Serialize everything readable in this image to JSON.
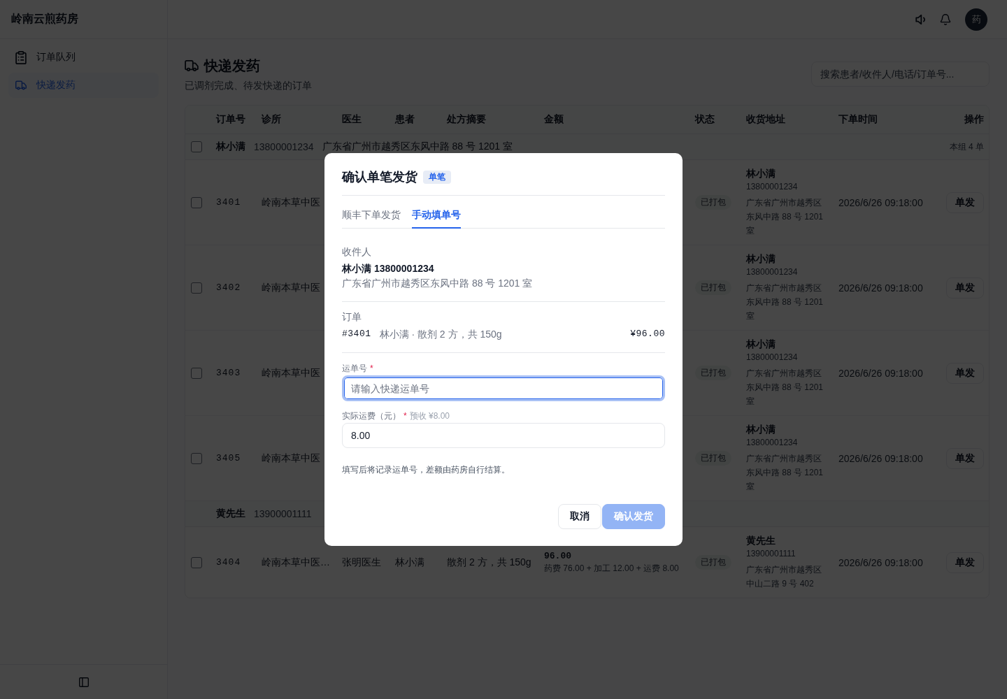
{
  "sidebar": {
    "brand": "岭南云煎药房",
    "items": [
      {
        "label": "订单队列",
        "selected": false
      },
      {
        "label": "快递发药",
        "selected": true
      }
    ]
  },
  "topbar": {
    "avatar": "药"
  },
  "page": {
    "title": "快递发药",
    "subtitle": "已调剂完成、待发快递的订单",
    "search": {
      "placeholder": "搜索患者/收件人/电话/订单号..."
    }
  },
  "table": {
    "columns": [
      "订单号",
      "诊所",
      "医生",
      "患者",
      "处方摘要",
      "金额",
      "状态",
      "收货地址",
      "下单时间",
      "操作"
    ],
    "groups": [
      {
        "checked": false,
        "name": "林小满",
        "phone": "13800001234",
        "address": "广东省广州市越秀区东风中路 88 号 1201 室",
        "count": "本组 4 单",
        "rows": [
          {
            "checked": false,
            "order_no": "3401",
            "clinic": "岭南本草中医",
            "status": "已打包",
            "recipient": {
              "name": "林小满",
              "phone": "13800001234",
              "address": "广东省广州市越秀区东风中路 88 号 1201 室"
            },
            "time": "2026/6/26 09:18:00",
            "action": "单发"
          },
          {
            "checked": false,
            "order_no": "3402",
            "clinic": "岭南本草中医",
            "status": "已打包",
            "recipient": {
              "name": "林小满",
              "phone": "13800001234",
              "address": "广东省广州市越秀区东风中路 88 号 1201 室"
            },
            "time": "2026/6/26 09:18:00",
            "action": "单发"
          },
          {
            "checked": false,
            "order_no": "3403",
            "clinic": "岭南本草中医",
            "status": "已打包",
            "recipient": {
              "name": "林小满",
              "phone": "13800001234",
              "address": "广东省广州市越秀区东风中路 88 号 1201 室"
            },
            "time": "2026/6/26 09:18:00",
            "action": "单发"
          },
          {
            "checked": false,
            "order_no": "3405",
            "clinic": "岭南本草中医",
            "status": "已打包",
            "recipient": {
              "name": "林小满",
              "phone": "13800001234",
              "address": "广东省广州市越秀区东风中路 88 号 1201 室"
            },
            "time": "2026/6/26 09:18:00",
            "action": "单发"
          }
        ]
      },
      {
        "name": "黄先生",
        "phone": "13900001111",
        "rows": [
          {
            "checked": false,
            "order_no": "3404",
            "clinic": "岭南本草中医…",
            "doctor": "张明医生",
            "patient": "林小满",
            "summary": "散剂 2 方，共 150g",
            "amount": "96.00",
            "amount_detail": "药费 76.00 + 加工 12.00 + 运费 8.00",
            "status": "已打包",
            "recipient": {
              "name": "黄先生",
              "phone": "13900001111",
              "address": "广东省广州市越秀区中山二路 9 号 402"
            },
            "time": "2026/6/26 09:18:00",
            "action": "单发"
          }
        ]
      }
    ]
  },
  "modal": {
    "title": "确认单笔发货",
    "badge": "单笔",
    "tabs": [
      {
        "label": "顺丰下单发货",
        "selected": false
      },
      {
        "label": "手动填单号",
        "selected": true
      }
    ],
    "recipient": {
      "label": "收件人",
      "name_phone": "林小满 13800001234",
      "address": "广东省广州市越秀区东风中路 88 号 1201 室"
    },
    "order": {
      "label": "订单",
      "number": "#3401",
      "summary": "林小满 · 散剂 2 方，共 150g",
      "amount": "¥96.00"
    },
    "fields": [
      {
        "label": "运单号",
        "required_mark": "*",
        "placeholder": "请输入快递运单号",
        "focused": true
      },
      {
        "label": "实际运费（元）",
        "required_mark": "*",
        "hint": "预收 ¥8.00",
        "value": "8.00",
        "focused": false
      }
    ],
    "note": "填写后将记录运单号，差额由药房自行结算。",
    "buttons": [
      {
        "label": "取消",
        "kind": "secondary",
        "disabled": false
      },
      {
        "label": "确认发货",
        "kind": "primary",
        "disabled": true
      }
    ]
  }
}
